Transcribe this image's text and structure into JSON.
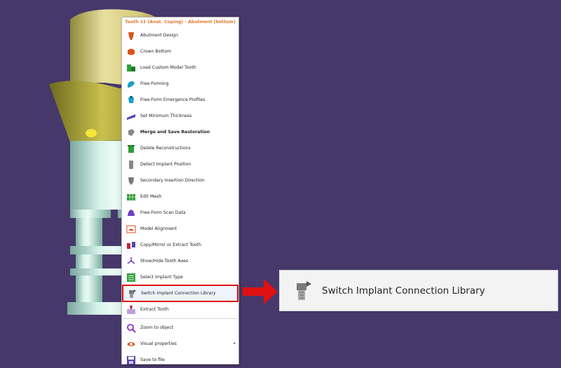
{
  "menu": {
    "title": "Tooth 11 (Anat. Coping) - Abutment (bottom)",
    "items": [
      {
        "label": "Abutment Design",
        "icon": "abutment-design-icon"
      },
      {
        "label": "Crown Bottom",
        "icon": "crown-bottom-icon"
      },
      {
        "label": "Load Custom Model Tooth",
        "icon": "load-custom-tooth-icon"
      },
      {
        "label": "Free-Forming",
        "icon": "free-forming-icon"
      },
      {
        "label": "Free-Form Emergence Profiles",
        "icon": "emergence-profile-icon"
      },
      {
        "label": "Set Minimum Thickness",
        "icon": "min-thickness-icon"
      },
      {
        "label": "Merge and Save Restoration",
        "icon": "merge-save-icon"
      },
      {
        "label": "Delete Reconstructions",
        "icon": "trash-icon"
      },
      {
        "label": "Detect Implant Position",
        "icon": "implant-detect-icon"
      },
      {
        "label": "Secondary Insertion Direction",
        "icon": "insertion-direction-icon"
      },
      {
        "label": "Edit Mesh",
        "icon": "edit-mesh-icon"
      },
      {
        "label": "Free-Form Scan Data",
        "icon": "scan-data-icon"
      },
      {
        "label": "Model Alignment",
        "icon": "model-alignment-icon"
      },
      {
        "label": "Copy/Mirror or Extract Tooth",
        "icon": "copy-mirror-icon"
      },
      {
        "label": "Show/Hide Tooth Axes",
        "icon": "tooth-axes-icon"
      },
      {
        "label": "Select Implant Type",
        "icon": "implant-type-icon"
      },
      {
        "label": "Switch Implant Connection Library",
        "icon": "implant-connection-icon"
      },
      {
        "label": "Extract Tooth",
        "icon": "extract-tooth-icon"
      },
      {
        "label": "Zoom to object",
        "icon": "zoom-icon"
      },
      {
        "label": "Visual properties",
        "icon": "eye-icon"
      },
      {
        "label": "Save to file",
        "icon": "save-icon"
      }
    ]
  },
  "callout": {
    "label": "Switch Implant Connection Library",
    "icon": "implant-connection-icon"
  },
  "colors": {
    "background": "#47386b",
    "title": "#e07a2a",
    "highlight": "#e01010",
    "crown": "#d9cf80",
    "shaft": "#b9e0d6"
  }
}
